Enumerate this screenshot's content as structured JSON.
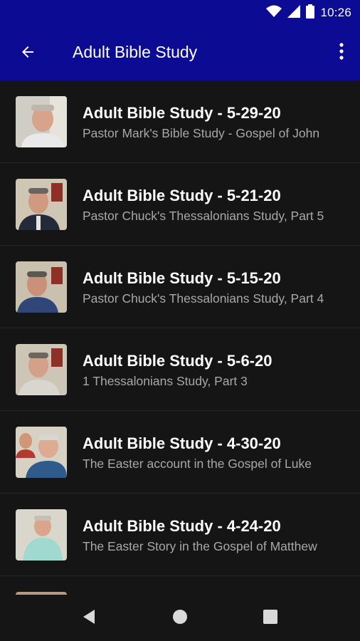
{
  "status_bar": {
    "time": "10:26",
    "icons": [
      "wifi-icon",
      "cell-signal-icon",
      "battery-icon"
    ]
  },
  "app_bar": {
    "title": "Adult Bible Study",
    "back_icon": "arrow-back-icon",
    "menu_icon": "more-vert-icon",
    "color": "#0b0b93"
  },
  "list": {
    "items": [
      {
        "title": "Adult Bible Study - 5-29-20",
        "subtitle": "Pastor Mark's Bible Study - Gospel of John"
      },
      {
        "title": "Adult Bible Study - 5-21-20",
        "subtitle": "Pastor Chuck's Thessalonians Study, Part 5"
      },
      {
        "title": "Adult Bible Study - 5-15-20",
        "subtitle": "Pastor Chuck's Thessalonians Study, Part 4"
      },
      {
        "title": "Adult Bible Study - 5-6-20",
        "subtitle": "1 Thessalonians Study, Part 3"
      },
      {
        "title": "Adult Bible Study - 4-30-20",
        "subtitle": "The Easter account in the Gospel of Luke"
      },
      {
        "title": "Adult Bible Study - 4-24-20",
        "subtitle": "The Easter Story in the Gospel of Matthew"
      }
    ]
  },
  "nav_bar": {
    "icons": [
      "nav-back-icon",
      "nav-home-icon",
      "nav-recents-icon"
    ]
  }
}
